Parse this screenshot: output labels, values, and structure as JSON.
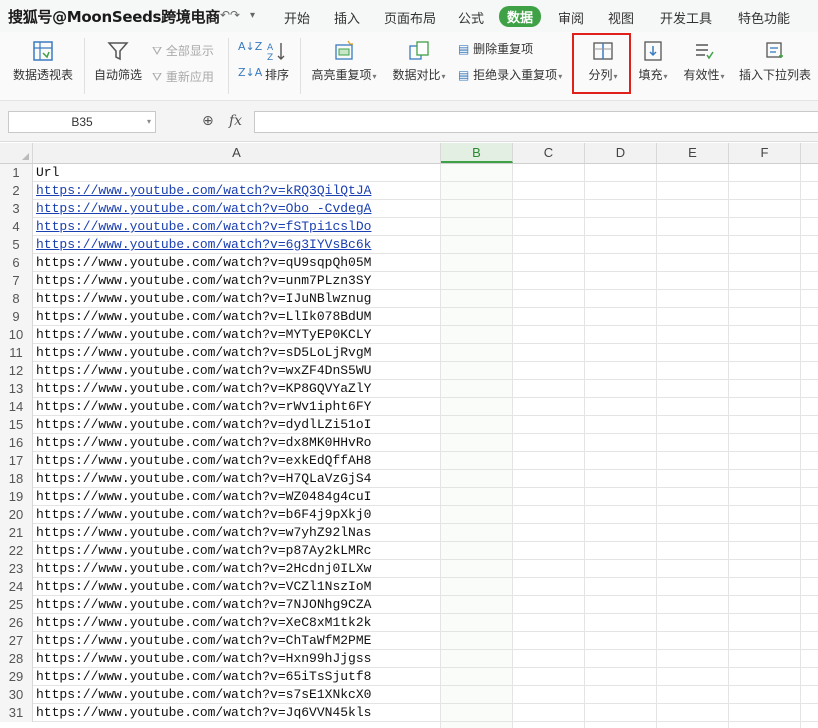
{
  "watermark": "搜狐号@MoonSeeds跨境电商",
  "menu": {
    "tabs": [
      "开始",
      "插入",
      "页面布局",
      "公式",
      "数据",
      "审阅",
      "视图",
      "开发工具",
      "特色功能"
    ],
    "active_tab": "数据"
  },
  "ribbon": {
    "pivot": "数据透视表",
    "autofilter": "自动筛选",
    "show_all": "全部显示",
    "reapply": "重新应用",
    "sort": "排序",
    "highlight_dup": "高亮重复项",
    "compare": "数据对比",
    "remove_dup": "删除重复项",
    "reject_dup": "拒绝录入重复项",
    "split_column": "分列",
    "fill": "填充",
    "validity": "有效性",
    "insert_dropdown": "插入下拉列表"
  },
  "formula_bar": {
    "name_box": "B35",
    "fx_label": "fx"
  },
  "columns": [
    "A",
    "B",
    "C",
    "D",
    "E",
    "F"
  ],
  "selected_column": "B",
  "rows": [
    {
      "n": "1",
      "a": "Url",
      "link": false
    },
    {
      "n": "2",
      "a": "https://www.youtube.com/watch?v=kRQ3QilQtJA",
      "link": true
    },
    {
      "n": "3",
      "a": "https://www.youtube.com/watch?v=Obo_-CvdegA",
      "link": true
    },
    {
      "n": "4",
      "a": "https://www.youtube.com/watch?v=fSTpi1cslDo",
      "link": true
    },
    {
      "n": "5",
      "a": "https://www.youtube.com/watch?v=6g3IYVsBc6k",
      "link": true
    },
    {
      "n": "6",
      "a": "https://www.youtube.com/watch?v=qU9sqpQh05M",
      "link": false
    },
    {
      "n": "7",
      "a": "https://www.youtube.com/watch?v=unm7PLzn3SY",
      "link": false
    },
    {
      "n": "8",
      "a": "https://www.youtube.com/watch?v=IJuNBlwznug",
      "link": false
    },
    {
      "n": "9",
      "a": "https://www.youtube.com/watch?v=LlIk078BdUM",
      "link": false
    },
    {
      "n": "10",
      "a": "https://www.youtube.com/watch?v=MYTyEP0KCLY",
      "link": false
    },
    {
      "n": "11",
      "a": "https://www.youtube.com/watch?v=sD5LoLjRvgM",
      "link": false
    },
    {
      "n": "12",
      "a": "https://www.youtube.com/watch?v=wxZF4DnS5WU",
      "link": false
    },
    {
      "n": "13",
      "a": "https://www.youtube.com/watch?v=KP8GQVYaZlY",
      "link": false
    },
    {
      "n": "14",
      "a": "https://www.youtube.com/watch?v=rWv1ipht6FY",
      "link": false
    },
    {
      "n": "15",
      "a": "https://www.youtube.com/watch?v=dydlLZi51oI",
      "link": false
    },
    {
      "n": "16",
      "a": "https://www.youtube.com/watch?v=dx8MK0HHvRo",
      "link": false
    },
    {
      "n": "17",
      "a": "https://www.youtube.com/watch?v=exkEdQffAH8",
      "link": false
    },
    {
      "n": "18",
      "a": "https://www.youtube.com/watch?v=H7QLaVzGjS4",
      "link": false
    },
    {
      "n": "19",
      "a": "https://www.youtube.com/watch?v=WZ0484g4cuI",
      "link": false
    },
    {
      "n": "20",
      "a": "https://www.youtube.com/watch?v=b6F4j9pXkj0",
      "link": false
    },
    {
      "n": "21",
      "a": "https://www.youtube.com/watch?v=w7yhZ92lNas",
      "link": false
    },
    {
      "n": "22",
      "a": "https://www.youtube.com/watch?v=p87Ay2kLMRc",
      "link": false
    },
    {
      "n": "23",
      "a": "https://www.youtube.com/watch?v=2Hcdnj0ILXw",
      "link": false
    },
    {
      "n": "24",
      "a": "https://www.youtube.com/watch?v=VCZl1NszIoM",
      "link": false
    },
    {
      "n": "25",
      "a": "https://www.youtube.com/watch?v=7NJONhg9CZA",
      "link": false
    },
    {
      "n": "26",
      "a": "https://www.youtube.com/watch?v=XeC8xM1tk2k",
      "link": false
    },
    {
      "n": "27",
      "a": "https://www.youtube.com/watch?v=ChTaWfM2PME",
      "link": false
    },
    {
      "n": "28",
      "a": "https://www.youtube.com/watch?v=Hxn99hJjgss",
      "link": false
    },
    {
      "n": "29",
      "a": "https://www.youtube.com/watch?v=65iTsSjutf8",
      "link": false
    },
    {
      "n": "30",
      "a": "https://www.youtube.com/watch?v=s7sE1XNkcX0",
      "link": false
    },
    {
      "n": "31",
      "a": "https://www.youtube.com/watch?v=Jq6VVN45kls",
      "link": false
    }
  ],
  "colors": {
    "accent_green": "#3fa146",
    "highlight_red": "#e0201a",
    "link_blue": "#1a3fb0"
  }
}
